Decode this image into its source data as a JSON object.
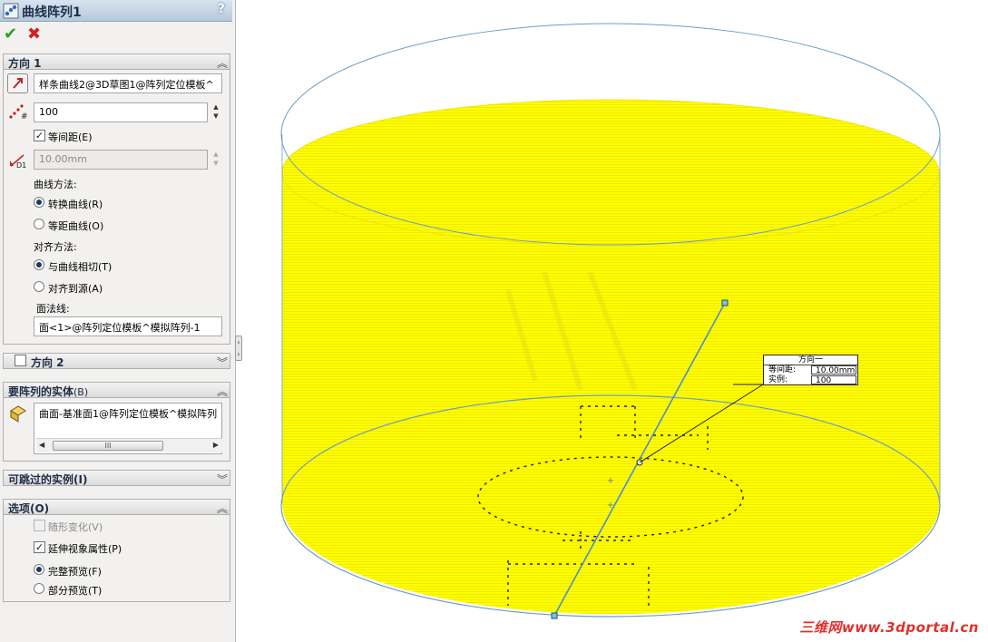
{
  "panel": {
    "title": "曲线阵列1",
    "help": "?",
    "ok_symbol": "✔",
    "cancel_symbol": "✖"
  },
  "direction1": {
    "header": "方向 1",
    "curve_ref": "样条曲线2@3D草图1@阵列定位模板^",
    "instances": "100",
    "equal_spacing_label": "等间距(E)",
    "equal_spacing_checked": true,
    "spacing": "10.00mm",
    "curve_method_label": "曲线方法:",
    "curve_methods": [
      "转换曲线(R)",
      "等距曲线(O)"
    ],
    "curve_method_selected": 0,
    "align_method_label": "对齐方法:",
    "align_methods": [
      "与曲线相切(T)",
      "对齐到源(A)"
    ],
    "align_method_selected": 0,
    "face_normal_label": "面法线:",
    "face_normal_value": "面<1>@阵列定位模板^模拟阵列-1"
  },
  "direction2": {
    "header": "方向 2",
    "checked": false
  },
  "bodies": {
    "header_main": "要阵列的实体",
    "header_suffix": "(B)",
    "value": "曲面-基准面1@阵列定位模板^模拟阵列",
    "scroll_thumb": "III"
  },
  "skip": {
    "header": "可跳过的实例(I)"
  },
  "options": {
    "header": "选项(O)",
    "vary_sketch": {
      "label": "随形变化(V)",
      "checked": false,
      "enabled": false
    },
    "propagate_visual": {
      "label": "延伸视象属性(P)",
      "checked": true
    },
    "preview_options": [
      "完整预览(F)",
      "部分预览(T)"
    ],
    "preview_selected": 0
  },
  "callout": {
    "title": "方向一",
    "rows": [
      {
        "key": "等间距:",
        "value": "10.00mm"
      },
      {
        "key": "实例:",
        "value": "100"
      }
    ]
  },
  "watermark": "三维网www.3dportal.cn",
  "colors": {
    "pattern_fill": "#ffff00",
    "pattern_line": "#e8d800",
    "outline": "#6a9ec4",
    "sketch_line": "#4a8fcc"
  },
  "icons": {
    "feature": "curve-pattern-icon",
    "direction": "reverse-direction-icon",
    "instances": "instance-count-icon",
    "spacing": "spacing-icon",
    "bodies": "bodies-icon"
  }
}
